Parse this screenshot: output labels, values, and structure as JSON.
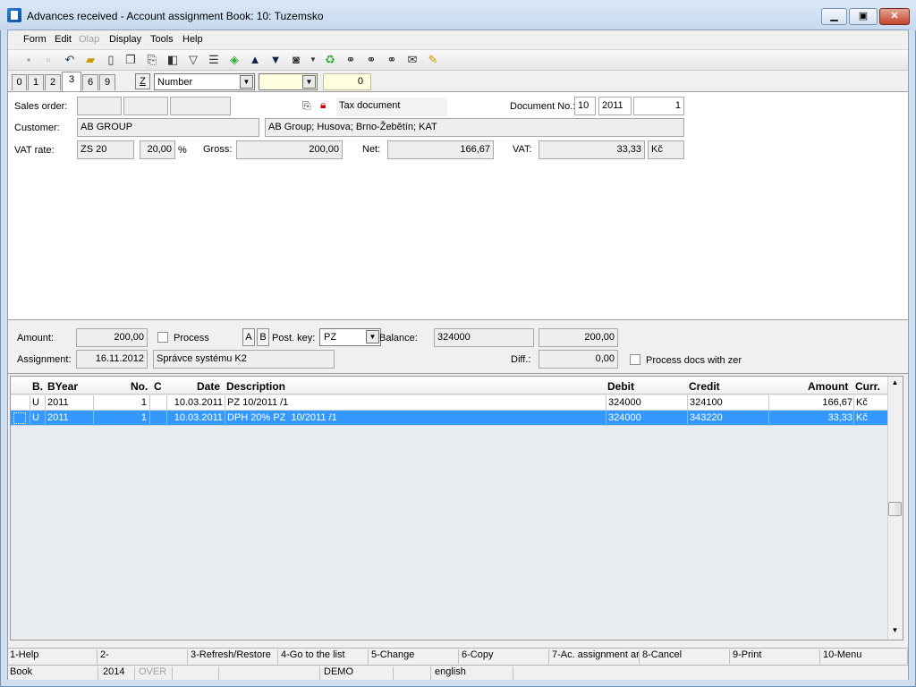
{
  "window": {
    "title": "Advances received - Account assignment   Book: 10: Tuzemsko",
    "min_icon": "minimize-icon",
    "max_icon": "maximize-icon",
    "close_icon": "close-icon"
  },
  "menu": {
    "items": [
      {
        "label": "Form",
        "enabled": true
      },
      {
        "label": "Edit",
        "enabled": true
      },
      {
        "label": "Olap",
        "enabled": false
      },
      {
        "label": "Display",
        "enabled": true
      },
      {
        "label": "Tools",
        "enabled": true
      },
      {
        "label": "Help",
        "enabled": true
      }
    ]
  },
  "toolbar": {
    "icons": [
      "save-icon",
      "save-as-icon",
      "undo-icon",
      "open-folder-icon",
      "new-document-icon",
      "copy-icon",
      "paste-icon",
      "book-icon",
      "filter-icon",
      "filter-list-icon",
      "stack-icon",
      "arrow-up-icon",
      "arrow-down-icon",
      "camera-icon",
      "dropdown-arrow-icon",
      "recycle-icon",
      "binoculars-icon",
      "binoculars-next-icon",
      "binoculars-prev-icon",
      "mail-icon",
      "notes-icon"
    ]
  },
  "tabs": [
    "0",
    "1",
    "2",
    "3",
    "6",
    "9"
  ],
  "active_tab": "3",
  "sort": {
    "z_label": "Z",
    "field": "Number",
    "count": "0"
  },
  "form": {
    "sales_order_label": "Sales order:",
    "sales_order_1": "",
    "sales_order_2": "",
    "sales_order_3": "",
    "tax_document": "Tax document",
    "document_no_label": "Document No.:",
    "doc_book": "10",
    "doc_year": "2011",
    "doc_number": "1",
    "customer_label": "Customer:",
    "customer_code": "AB GROUP",
    "customer_name": "AB Group; Husova; Brno-Žebětín; KAT",
    "vat_rate_label": "VAT rate:",
    "vat_rate_code": "ZS 20",
    "vat_rate_value": "20,00",
    "vat_percent": "%",
    "gross_label": "Gross:",
    "gross_value": "200,00",
    "net_label": "Net:",
    "net_value": "166,67",
    "vat_label": "VAT:",
    "vat_value": "33,33",
    "currency": "Kč"
  },
  "assignment": {
    "amount_label": "Amount:",
    "amount_value": "200,00",
    "process_label": "Process",
    "btn_a": "A",
    "btn_b": "B",
    "post_key_label": "Post. key:",
    "post_key_value": "PZ",
    "balance_label": "Balance:",
    "balance_account": "324000",
    "balance_value": "200,00",
    "assignment_label": "Assignment:",
    "assignment_date": "16.11.2012",
    "assignment_user": "Správce systému K2",
    "diff_label": "Diff.:",
    "diff_value": "0,00",
    "process_docs_label": "Process docs with zer"
  },
  "grid": {
    "headers": {
      "b": "B.",
      "byear": "BYear",
      "no": "No.",
      "c": "C",
      "date": "Date",
      "description": "Description",
      "debit": "Debit",
      "credit": "Credit",
      "amount": "Amount",
      "curr": "Curr."
    },
    "rows": [
      {
        "b": "U",
        "byear": "2011",
        "no": "1",
        "c": "",
        "date": "10.03.2011",
        "description": "PZ 10/2011 /1",
        "debit": "324000",
        "credit": "324100",
        "amount": "166,67",
        "curr": "Kč",
        "selected": false
      },
      {
        "b": "U",
        "byear": "2011",
        "no": "1",
        "c": "",
        "date": "10.03.2011",
        "description": "DPH 20% PZ  10/2011 /1",
        "debit": "324000",
        "credit": "343220",
        "amount": "33,33",
        "curr": "Kč",
        "selected": true
      }
    ]
  },
  "fkeys": [
    "1-Help",
    "2-",
    "3-Refresh/Restore",
    "4-Go to the list",
    "5-Change",
    "6-Copy",
    "7-Ac. assignment ar",
    "8-Cancel",
    "9-Print",
    "10-Menu"
  ],
  "status": {
    "book": "Book",
    "year": "2014",
    "over": "OVER",
    "demo": "DEMO",
    "language": "english"
  }
}
